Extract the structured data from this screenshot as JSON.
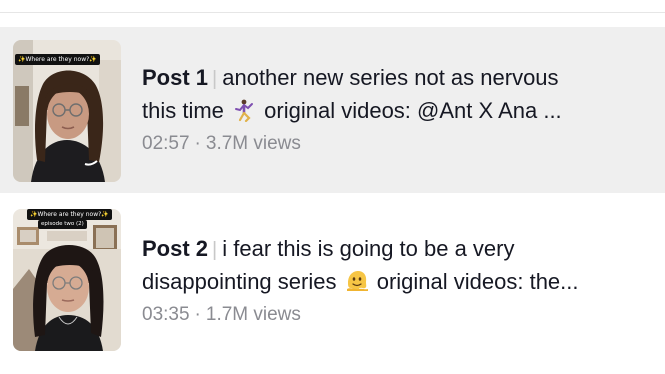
{
  "posts": [
    {
      "label": "Post 1",
      "caption_line1": "another new series not as nervous",
      "caption_line2_before_icon": "this time",
      "caption_line2_after_icon": "original videos:  @Ant X Ana  ...",
      "caption_icon": "dancer-icon",
      "duration": "02:57",
      "views": "3.7M views",
      "thumbnail_tag": "✨Where are they now?✨"
    },
    {
      "label": "Post 2",
      "caption_line1": "i fear this is going to be a very",
      "caption_line2_before_icon": "disappointing series",
      "caption_line2_after_icon": "original videos: the...",
      "caption_icon": "melting-face-icon",
      "duration": "03:35",
      "views": "1.7M views",
      "thumbnail_tag": "✨Where are they now?✨",
      "thumbnail_subtag": "episode two (2)"
    }
  ],
  "separator": "|",
  "meta_dot": "·",
  "colors": {
    "selected_row_bg": "#efefef",
    "meta_text": "#8a8b91",
    "primary_text": "#161823"
  }
}
